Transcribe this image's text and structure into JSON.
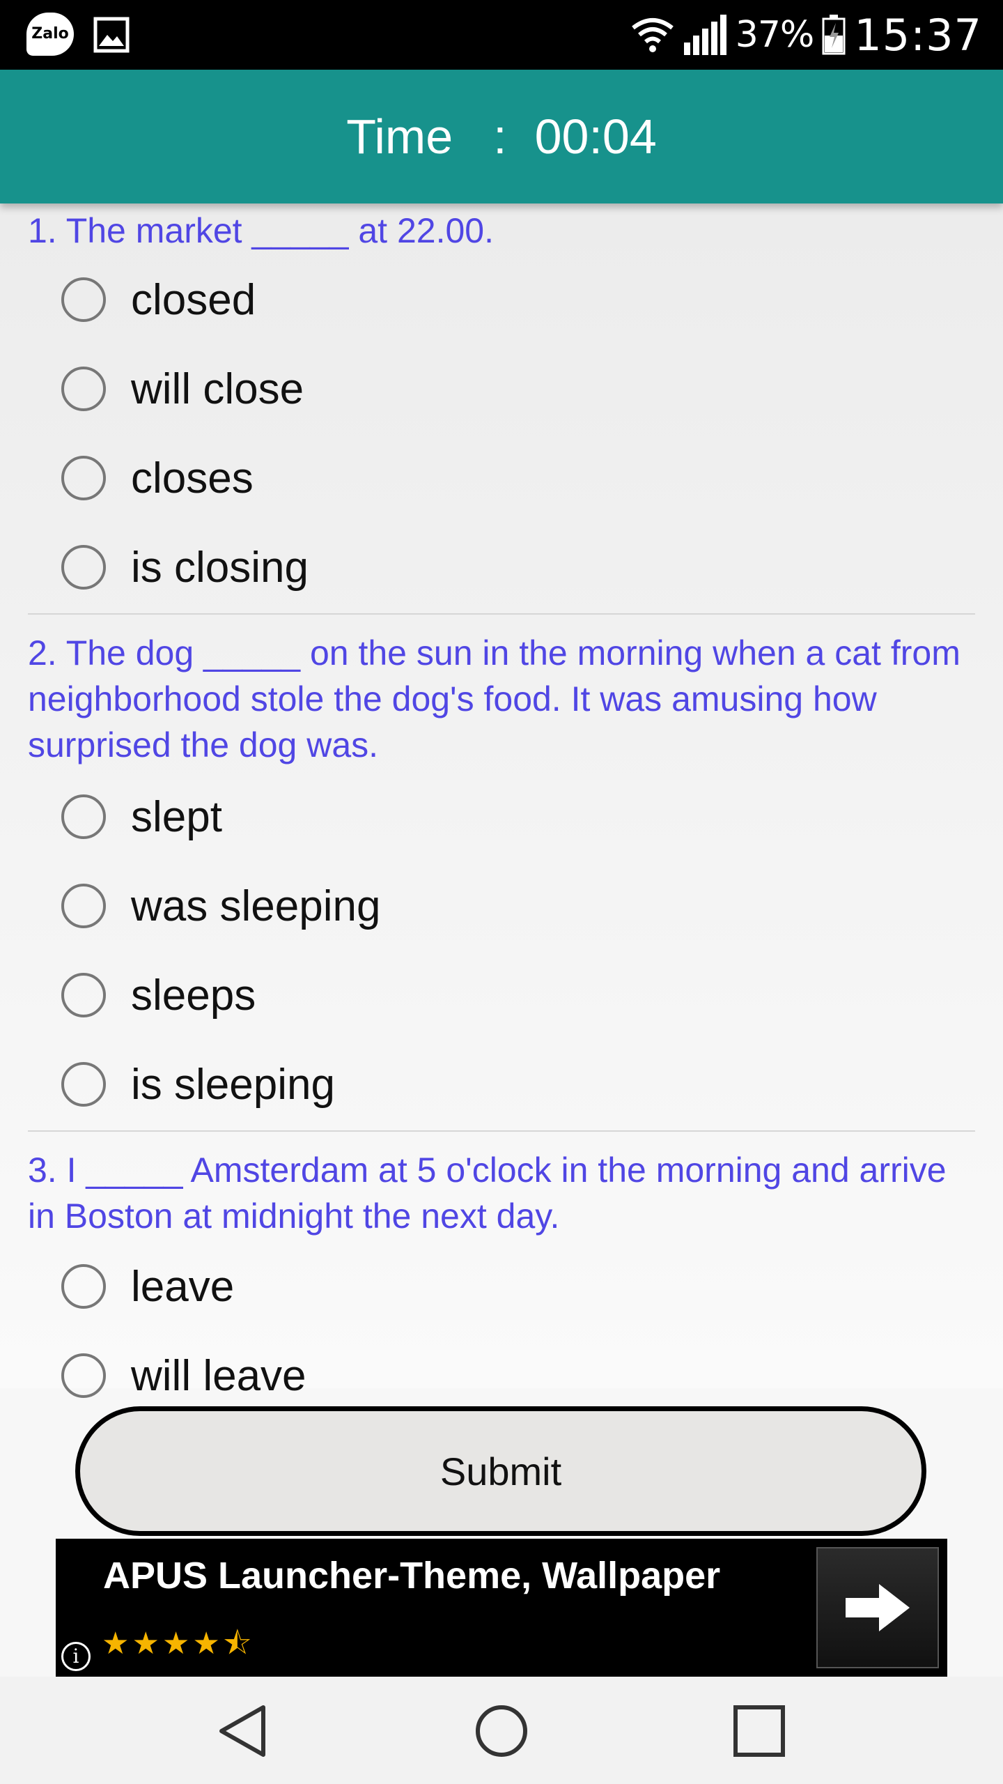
{
  "status_bar": {
    "zalo_label": "Zalo",
    "battery_percent": "37%",
    "time": "15:37",
    "icons": [
      "zalo-icon",
      "gallery-icon",
      "wifi-icon",
      "signal-icon",
      "battery-icon"
    ]
  },
  "header": {
    "label": "Time",
    "separator": ":",
    "value": "00:04",
    "color": "#17928c"
  },
  "questions": [
    {
      "text": "1. The market _____ at 22.00.",
      "options": [
        "closed",
        "will close",
        "closes",
        "is closing"
      ]
    },
    {
      "text": "2. The dog _____ on the sun in the morning when a cat from neighborhood stole the dog's food. It was amusing how surprised the dog was.",
      "options": [
        "slept",
        "was sleeping",
        "sleeps",
        "is sleeping"
      ]
    },
    {
      "text": "3. I _____ Amsterdam at 5 o'clock in the morning and arrive in Boston at midnight the next day.",
      "options": [
        "leave",
        "will leave"
      ]
    }
  ],
  "submit_label": "Submit",
  "ad": {
    "title": "APUS Launcher-Theme, Wallpaper",
    "stars": "★★★★⯪",
    "rating": 4.5,
    "info_label": "i"
  },
  "navbar": {
    "buttons": [
      "back-icon",
      "home-icon",
      "recents-icon"
    ]
  },
  "colors": {
    "question_text": "#5046e4",
    "header_bg": "#17928c"
  }
}
